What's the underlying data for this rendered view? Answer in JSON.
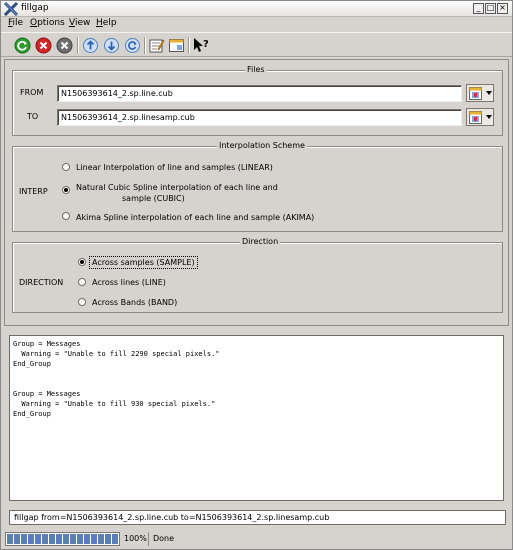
{
  "window": {
    "title": "fillgap"
  },
  "menubar": [
    {
      "label": "File"
    },
    {
      "label": "Options"
    },
    {
      "label": "View"
    },
    {
      "label": "Help"
    }
  ],
  "toolbar": {
    "icons": [
      "run-icon",
      "stop-icon",
      "reset-icon",
      "previous-icon",
      "next-icon",
      "refresh-icon",
      "edit-icon",
      "window-icon",
      "whats-this-icon"
    ]
  },
  "files": {
    "title": "Files",
    "from_label": "FROM",
    "from_value": "N1506393614_2.sp.line.cub",
    "to_label": "TO",
    "to_value": "N1506393614_2.sp.linesamp.cub"
  },
  "interp": {
    "title": "Interpolation Scheme",
    "label": "INTERP",
    "options": [
      {
        "label": "Linear Interpolation of line and samples (LINEAR)"
      },
      {
        "label_line1": "Natural Cubic Spline interpolation of each line and",
        "label_line2": "sample (CUBIC)"
      },
      {
        "label": "Akima Spline interpolation of each line and sample (AKIMA)"
      }
    ],
    "selected": "CUBIC"
  },
  "direction": {
    "title": "Direction",
    "label": "DIRECTION",
    "options": [
      {
        "label": "Across samples (SAMPLE)"
      },
      {
        "label": "Across lines (LINE)"
      },
      {
        "label": "Across Bands (BAND)"
      }
    ],
    "selected": "SAMPLE"
  },
  "log": {
    "lines": [
      "Group = Messages",
      "  Warning = \"Unable to fill 2290 special pixels.\"",
      "End_Group",
      "",
      "",
      "Group = Messages",
      "  Warning = \"Unable to fill 930 special pixels.\"",
      "End_Group"
    ]
  },
  "command": "fillgap from=N1506393614_2.sp.line.cub to=N1506393614_2.sp.linesamp.cub",
  "status": {
    "progress_percent": 100,
    "progress_label": "100%",
    "text": "Done"
  }
}
